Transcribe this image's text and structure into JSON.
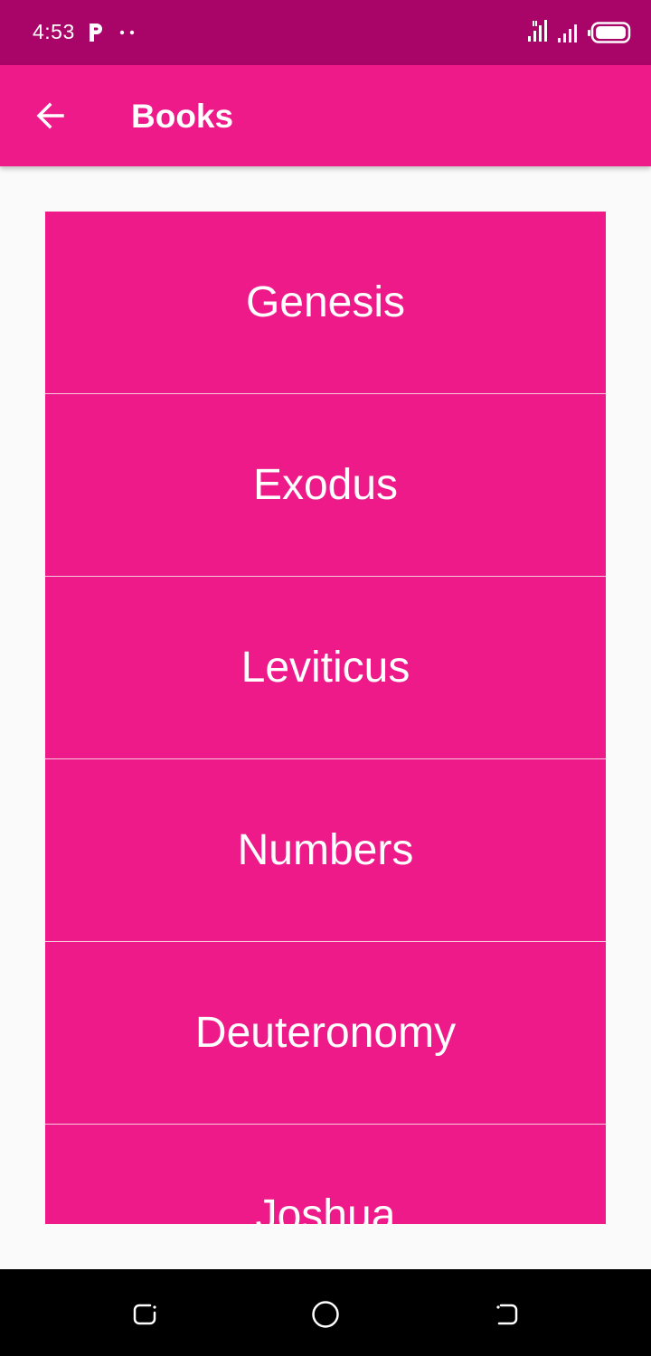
{
  "status_bar": {
    "time": "4:53",
    "icons": [
      "p-notification-icon",
      "more-dots-icon",
      "signal-icon",
      "signal-icon",
      "battery-icon"
    ]
  },
  "app_bar": {
    "title": "Books",
    "back_icon": "arrow-back-icon",
    "color": "#ee1a8a"
  },
  "books": [
    {
      "label": "Genesis"
    },
    {
      "label": "Exodus"
    },
    {
      "label": "Leviticus"
    },
    {
      "label": "Numbers"
    },
    {
      "label": "Deuteronomy"
    },
    {
      "label": "Joshua"
    }
  ],
  "nav_bar": {
    "icons": [
      "recent-apps-icon",
      "home-icon",
      "back-nav-icon"
    ]
  },
  "colors": {
    "status_bar": "#a90568",
    "accent": "#ee1a8a",
    "background": "#fafafa"
  }
}
